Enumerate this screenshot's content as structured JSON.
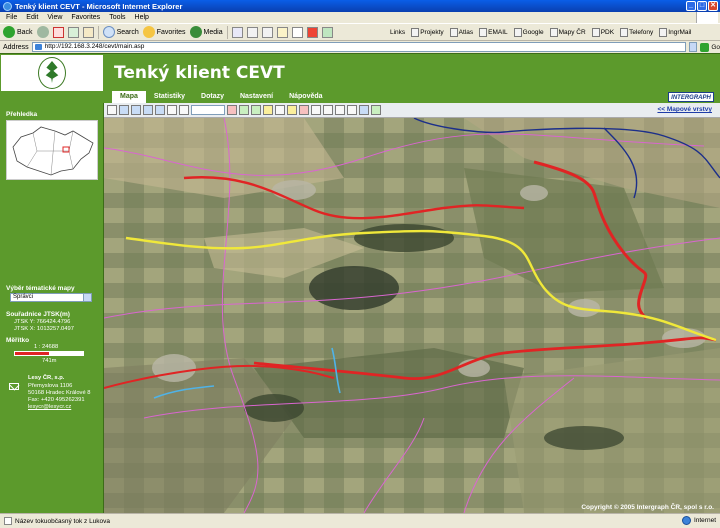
{
  "window": {
    "title": "Tenký klient CEVT - Microsoft Internet Explorer",
    "buttons": [
      "_",
      "□",
      "✕"
    ]
  },
  "menu": [
    "File",
    "Edit",
    "View",
    "Favorites",
    "Tools",
    "Help"
  ],
  "toolbar": {
    "back": "Back",
    "search": "Search",
    "favorites": "Favorites",
    "media": "Media",
    "links_label": "Links",
    "links": [
      "Projekty",
      "Atlas",
      "EMAIL",
      "Google",
      "Mapy ČR",
      "PDK",
      "Telefony",
      "IngrMail"
    ]
  },
  "address": {
    "label": "Address",
    "url": "http://192.168.3.248/cevt/main.asp",
    "go": "Go"
  },
  "app": {
    "title": "Tenký klient CEVT",
    "brand": "INTERGRAPH"
  },
  "tabs": [
    {
      "label": "Mapa",
      "active": true
    },
    {
      "label": "Statistiky",
      "active": false
    },
    {
      "label": "Dotazy",
      "active": false
    },
    {
      "label": "Nastavení",
      "active": false
    },
    {
      "label": "Nápověda",
      "active": false
    }
  ],
  "sidebar": {
    "overview_label": "Přehledka",
    "thematic_label": "Výběr tématické mapy",
    "thematic_value": "Správci",
    "coords_label": "Souřadnice JTSK(m)",
    "coord_y": "JTSK Y: 766424.4796",
    "coord_x": "JTSK X: 1013257.0497",
    "scale_label": "Měřítko",
    "scale_value": "1 : 24688",
    "scale_length": "741m",
    "contact": {
      "name": "Lesy ČR, s.p.",
      "street": "Přemyslova 1106",
      "city": "50168 Hradec Králové 8",
      "fax": "Fax: +420 495262391",
      "email": "lesycr@lesycr.cz"
    }
  },
  "map": {
    "layers_link": "<< Mapové vrstvy",
    "copyright": "Copyright © 2005 Intergraph ČR, spol s r.o."
  },
  "status": {
    "text": "Název tokuobčasný tok z Lukova",
    "zone": "Internet"
  },
  "colors": {
    "header_green": "#5c9a2c",
    "stream_red": "#e02424",
    "stream_yellow": "#f0e83a",
    "boundary_pink": "#d966d0",
    "boundary_blue": "#1c2f8a"
  }
}
